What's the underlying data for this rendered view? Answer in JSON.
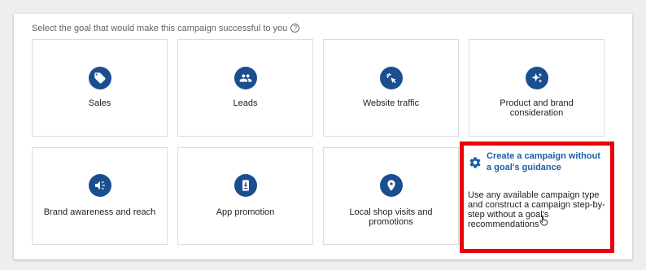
{
  "prompt": {
    "text": "Select the goal that would make this campaign successful to you",
    "help_icon": "help-circle-icon"
  },
  "goals": [
    {
      "label": "Sales",
      "icon": "tag-icon"
    },
    {
      "label": "Leads",
      "icon": "people-icon"
    },
    {
      "label": "Website traffic",
      "icon": "cursor-click-icon"
    },
    {
      "label": "Product and brand consideration",
      "icon": "sparkle-icon"
    },
    {
      "label": "Brand awareness and reach",
      "icon": "speaker-icon"
    },
    {
      "label": "App promotion",
      "icon": "phone-download-icon"
    },
    {
      "label": "Local shop visits and promotions",
      "icon": "location-pin-icon"
    }
  ],
  "custom": {
    "title": "Create a campaign without a goal's guidance",
    "description": "Use any available campaign type and construct a campaign step-by-step without a goal's recommendations",
    "icon": "gear-icon"
  },
  "colors": {
    "accent": "#1a4e8f",
    "link": "#1a5ea8",
    "highlight": "#e8000b"
  }
}
